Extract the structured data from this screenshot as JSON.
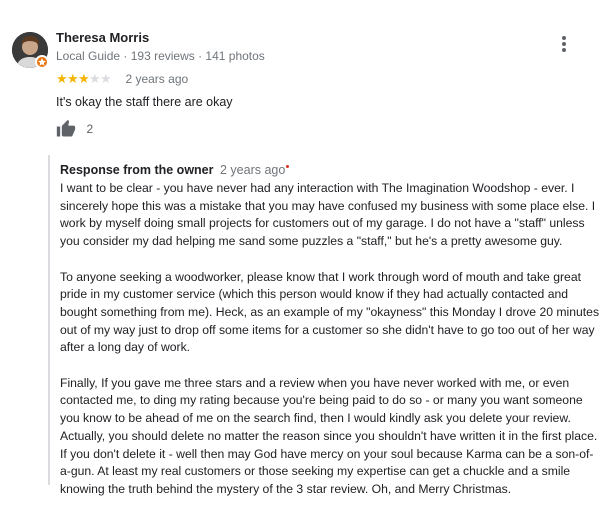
{
  "reviewer": {
    "name": "Theresa Morris",
    "badge": "Local Guide",
    "separator": " · ",
    "reviews": "193 reviews",
    "photos": "141 photos",
    "avatar_icon": "user-avatar",
    "badge_icon": "local-guide-star-icon"
  },
  "review": {
    "rating": 3,
    "max_rating": 5,
    "date": "2 years ago",
    "text": "It's okay the staff there are okay",
    "likes": "2",
    "like_icon": "thumbs-up-icon",
    "menu_icon": "more-vert-icon"
  },
  "owner_response": {
    "title": "Response from the owner",
    "date": "2 years ago",
    "paragraphs": [
      "I want to be clear - you have never had any interaction with The Imagination Woodshop - ever. I sincerely hope this was a mistake that you may have confused my business with some place else. I work by myself doing small projects for customers out of my garage. I do not have a \"staff\" unless you consider my dad helping me sand some puzzles a \"staff,\" but he's a pretty awesome guy.",
      "To anyone seeking a woodworker, please know that I work through word of mouth and take great pride in my customer service (which this person would know if they had actually contacted and bought something from me). Heck, as an example of my \"okayness\" this Monday I drove 20 minutes out of my way just to drop off some items for a customer so she didn't have to go too out of her way after a long day of work.",
      "Finally, If you gave me three stars and a review when you have never worked with me, or even contacted me, to ding my rating because you're being paid to do so - or many you want someone you know to be ahead of me on the search find, then I would kindly ask you delete your review. Actually, you should delete no matter the reason since you shouldn't have written it in the first place. If you don't delete it - well then may God have mercy on your soul because Karma can be a son-of-a-gun. At least my real customers or those seeking my expertise can get a chuckle and a smile knowing the truth behind the mystery of the 3 star review. Oh, and Merry Christmas."
    ]
  },
  "colors": {
    "star_on": "#f4b400",
    "star_off": "#dadce0",
    "guide_badge": "#e8710a",
    "secondary_text": "#70757a"
  }
}
